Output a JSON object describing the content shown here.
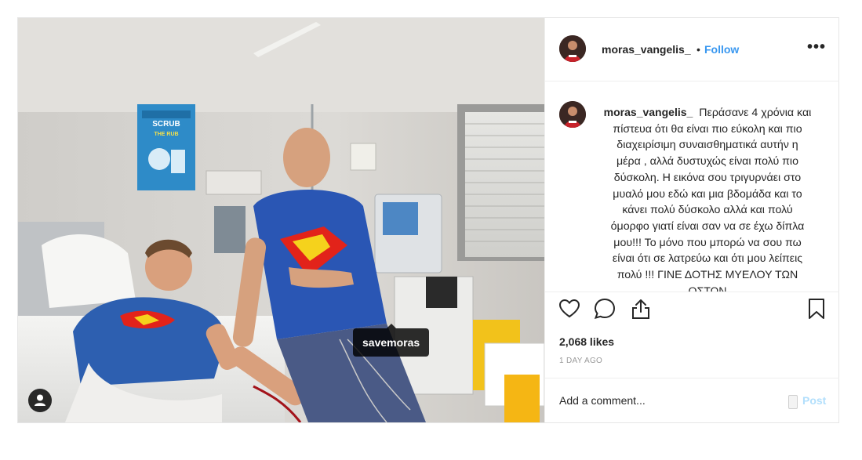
{
  "post": {
    "author": "moras_vangelis_",
    "separator": "•",
    "follow_label": "Follow",
    "more_label": "•••",
    "caption": "Περάσανε 4 χρόνια και πίστευα ότι θα είναι πιο εύκολη και πιο διαχειρίσιμη συναισθηματικά αυτήν η μέρα , αλλά δυστυχώς είναι πολύ πιο δύσκολη. Η εικόνα σου τριγυρνάει στο μυαλό μου εδώ και μια βδομάδα και το κάνει πολύ δύσκολο αλλά και πολύ όμορφο γιατί είναι σαν να σε έχω δίπλα μου!!! Το μόνο που μπορώ να σου πω είναι ότι σε λατρεύω και ότι μου λείπεις πολύ !!! ΓΙΝΕ ΔΟΤΗΣ ΜΥΕΛΟΥ ΤΩΝ ΟΣΤΩΝ",
    "likes": "2,068 likes",
    "time": "1 DAY AGO",
    "comment_placeholder": "Add a comment...",
    "post_label": "Post"
  },
  "photo": {
    "tag_label": "savemoras",
    "poster_text_1": "SCRUB",
    "poster_text_2": "THE RUB"
  },
  "icons": {
    "like": "heart-icon",
    "comment": "comment-icon",
    "share": "share-icon",
    "save": "bookmark-icon",
    "tagged_users": "user-icon"
  },
  "colors": {
    "link": "#3897f0",
    "post_disabled": "#b2dffc",
    "text": "#262626",
    "muted": "#999999",
    "border": "#efefef"
  }
}
